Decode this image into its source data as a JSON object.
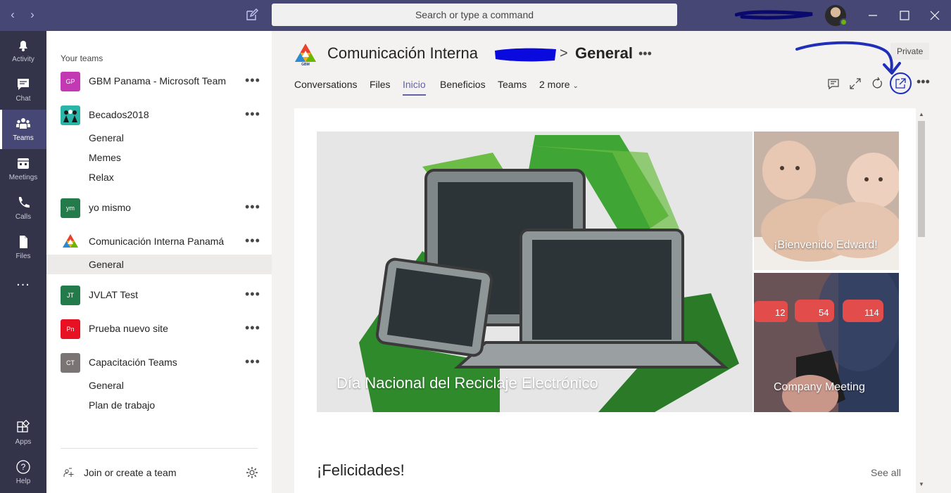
{
  "titlebar": {
    "search_placeholder": "Search or type a command"
  },
  "rail": {
    "items": [
      {
        "label": "Activity",
        "icon": "bell-icon"
      },
      {
        "label": "Chat",
        "icon": "chat-icon"
      },
      {
        "label": "Teams",
        "icon": "teams-icon"
      },
      {
        "label": "Meetings",
        "icon": "calendar-icon"
      },
      {
        "label": "Calls",
        "icon": "phone-icon"
      },
      {
        "label": "Files",
        "icon": "file-icon"
      },
      {
        "label": "Apps",
        "icon": "apps-icon"
      },
      {
        "label": "Help",
        "icon": "help-icon"
      }
    ],
    "more": "..."
  },
  "teams_pane": {
    "header": "Your teams",
    "teams": [
      {
        "initials": "GP",
        "name": "GBM Panama - Microsoft Team",
        "color": "#c239b3"
      },
      {
        "initials": "",
        "name": "Becados2018",
        "color": "#2bb5a8",
        "channels": [
          "General",
          "Memes",
          "Relax"
        ]
      },
      {
        "initials": "ym",
        "name": "yo mismo",
        "color": "#237b4b"
      },
      {
        "initials": "",
        "name": "Comunicación Interna Panamá",
        "color": "#ffffff",
        "channels": [
          "General"
        ]
      },
      {
        "initials": "JT",
        "name": "JVLAT Test",
        "color": "#237b4b"
      },
      {
        "initials": "Pn",
        "name": "Prueba nuevo site",
        "color": "#e81123"
      },
      {
        "initials": "CT",
        "name": "Capacitación Teams",
        "color": "#7a7574",
        "channels": [
          "General",
          "Plan de trabajo"
        ]
      }
    ],
    "more": "•••",
    "join_label": "Join or create a team"
  },
  "header": {
    "team_title": "Comunicación Interna",
    "separator": ">",
    "channel_title": "General",
    "more": "•••",
    "badge": "Private",
    "tabs": [
      "Conversations",
      "Files",
      "Inicio",
      "Beneficios",
      "Teams",
      "2 more"
    ],
    "active_tab": "Inicio"
  },
  "content": {
    "hero_caption": "Día Nacional del Reciclaje Electrónico",
    "tile1_caption": "¡Bienvenido Edward!",
    "tile2_caption": "Company Meeting",
    "tile2_counts": [
      "12",
      "54",
      "114"
    ],
    "section_title": "¡Felicidades!",
    "see_all": "See all"
  },
  "colors": {
    "titlebar": "#464775",
    "rail": "#33344a",
    "accent": "#6264a7",
    "annotation": "#1f2fb8"
  }
}
